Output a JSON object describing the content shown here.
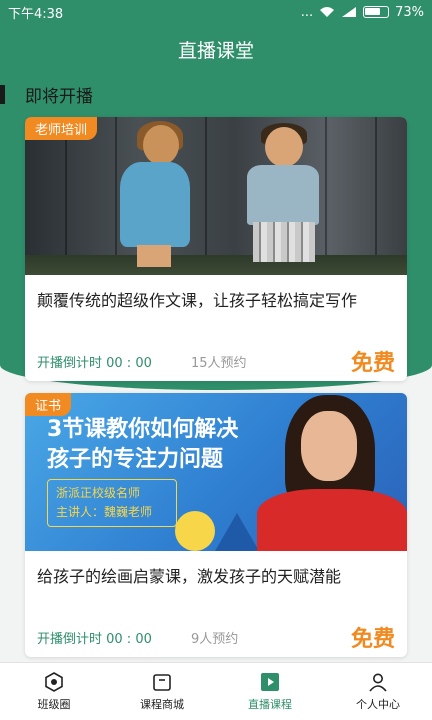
{
  "status_bar": {
    "time": "下午4:38",
    "dots": "...",
    "battery": "73%"
  },
  "header": {
    "title": "直播课堂"
  },
  "section": {
    "title": "即将开播"
  },
  "cards": [
    {
      "tag": "老师培训",
      "title": "颠覆传统的超级作文课，让孩子轻松搞定写作",
      "countdown": "开播倒计时 00 : 00",
      "booked": "15人预约",
      "price": "免费"
    },
    {
      "tag": "证书",
      "banner_line1": "3节课教你如何解决",
      "banner_line2": "孩子的专注力问题",
      "banner_box_line1": "浙派正校级名师",
      "banner_box_line2": "主讲人：魏巍老师",
      "title": "给孩子的绘画启蒙课，激发孩子的天赋潜能",
      "countdown": "开播倒计时 00 : 00",
      "booked": "9人预约",
      "price": "免费"
    }
  ],
  "tabs": [
    {
      "label": "班级圈",
      "icon": "class-circle-icon"
    },
    {
      "label": "课程商城",
      "icon": "course-mall-icon"
    },
    {
      "label": "直播课程",
      "icon": "live-course-icon",
      "active": true
    },
    {
      "label": "个人中心",
      "icon": "profile-icon"
    }
  ],
  "colors": {
    "primary": "#2f8f6b",
    "accent": "#f08a21",
    "background": "#f2f4f3"
  }
}
